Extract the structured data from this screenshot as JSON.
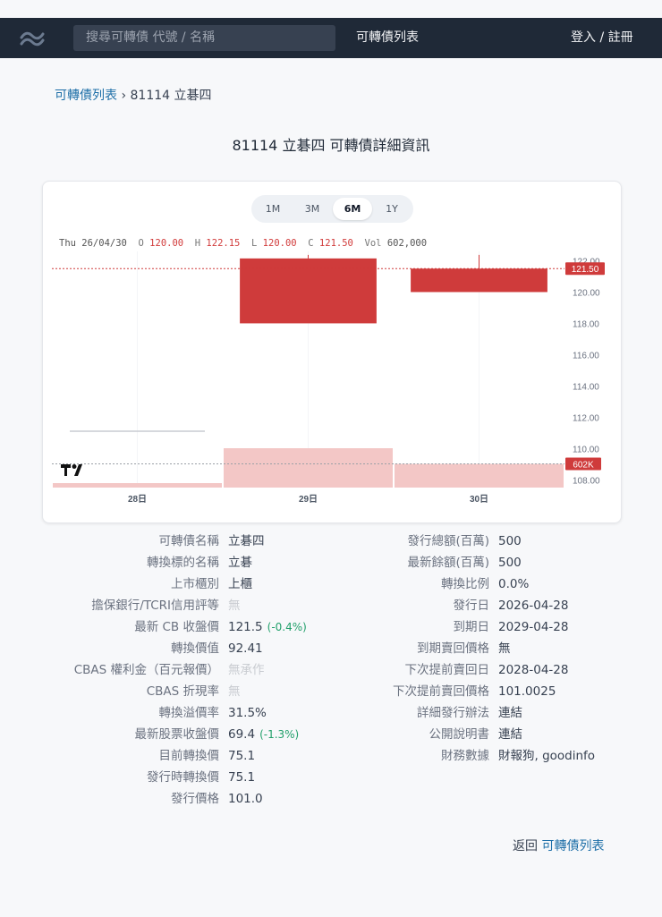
{
  "nav": {
    "search_placeholder": "搜尋可轉債 代號 / 名稱",
    "list_link": "可轉債列表",
    "login": "登入 / 註冊"
  },
  "breadcrumb": {
    "root": "可轉債列表",
    "separator": "›",
    "current": "81114 立碁四"
  },
  "page_title": "81114 立碁四 可轉債詳細資訊",
  "chart": {
    "ranges": [
      "1M",
      "3M",
      "6M",
      "1Y"
    ],
    "active_range": "6M",
    "ohlc": {
      "date": "Thu 26/04/30",
      "o_label": "O",
      "o": "120.00",
      "h_label": "H",
      "h": "122.15",
      "l_label": "L",
      "l": "120.00",
      "c_label": "C",
      "c": "121.50",
      "vol_label": "Vol",
      "vol": "602,000"
    },
    "last_price_tag": "121.50",
    "volume_tag": "602K",
    "up_color": "#cf3b3b",
    "volume_color": "#f3c7c6"
  },
  "chart_data": {
    "type": "candlestick",
    "x": [
      "28日",
      "29日",
      "30日"
    ],
    "candles": [
      {
        "x": "29日",
        "open": 118.0,
        "high": 122.15,
        "low": 118.0,
        "close": 122.15
      },
      {
        "x": "30日",
        "open": 120.0,
        "high": 122.15,
        "low": 120.0,
        "close": 121.5
      }
    ],
    "volume": [
      {
        "x": "28日",
        "value": 40
      },
      {
        "x": "29日",
        "value": 1000
      },
      {
        "x": "30日",
        "value": 602
      }
    ],
    "y_ticks": [
      "108.00",
      "110.00",
      "112.00",
      "114.00",
      "116.00",
      "118.00",
      "120.00",
      "122.00"
    ],
    "ylim": [
      107.5,
      122.6
    ],
    "last_price": 121.5
  },
  "info_left": [
    {
      "label": "可轉債名稱",
      "value": "立碁四"
    },
    {
      "label": "轉換標的名稱",
      "value": "立碁"
    },
    {
      "label": "上市櫃別",
      "value": "上櫃"
    },
    {
      "label": "擔保銀行/TCRI信用評等",
      "value": "無",
      "muted": true
    },
    {
      "label": "最新 CB 收盤價",
      "value": "121.5",
      "change": "(-0.4%)"
    },
    {
      "label": "轉換價值",
      "value": "92.41"
    },
    {
      "label": "CBAS 權利金（百元報價）",
      "value": "無承作",
      "muted": true
    },
    {
      "label": "CBAS 折現率",
      "value": "無",
      "muted": true
    },
    {
      "label": "轉換溢價率",
      "value": "31.5%"
    },
    {
      "label": "最新股票收盤價",
      "value": "69.4",
      "change": "(-1.3%)"
    },
    {
      "label": "目前轉換價",
      "value": "75.1"
    },
    {
      "label": "發行時轉換價",
      "value": "75.1"
    },
    {
      "label": "發行價格",
      "value": "101.0"
    }
  ],
  "info_right": [
    {
      "label": "發行總額(百萬)",
      "value": "500"
    },
    {
      "label": "最新餘額(百萬)",
      "value": "500"
    },
    {
      "label": "轉換比例",
      "value": "0.0%"
    },
    {
      "label": "發行日",
      "value": "2026-04-28"
    },
    {
      "label": "到期日",
      "value": "2029-04-28"
    },
    {
      "label": "到期賣回價格",
      "value": "無"
    },
    {
      "label": "下次提前賣回日",
      "value": "2028-04-28"
    },
    {
      "label": "下次提前賣回價格",
      "value": "101.0025"
    },
    {
      "label": "詳細發行辦法",
      "value": "連結",
      "link": true
    },
    {
      "label": "公開說明書",
      "value": "連結",
      "link": true
    },
    {
      "label": "財務數據",
      "value": "財報狗, goodinfo",
      "link": true
    }
  ],
  "footer": {
    "back_text": "返回",
    "back_link": "可轉債列表"
  }
}
